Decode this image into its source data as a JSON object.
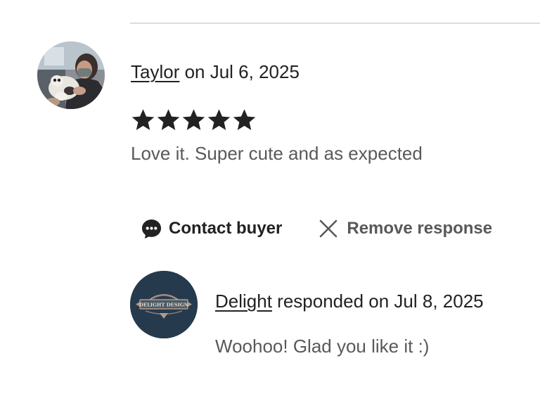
{
  "review": {
    "reviewer_name": "Taylor",
    "date_text": " on Jul 6, 2025",
    "rating": 5,
    "rating_max": 5,
    "text": "Love it. Super cute and as expected"
  },
  "actions": {
    "contact_label": "Contact buyer",
    "contact_icon": "chat-bubble-icon",
    "remove_label": "Remove response",
    "remove_icon": "close-icon"
  },
  "response": {
    "seller_name": "Delight",
    "date_text": " responded on Jul 8, 2025",
    "text": "Woohoo! Glad you like it :)",
    "logo_text": "DELIGHT DESIGN"
  },
  "colors": {
    "primary_text": "#222222",
    "secondary_text": "#595959",
    "divider": "#dddddd",
    "seller_avatar_bg": "#263a4d",
    "star": "#222222"
  }
}
